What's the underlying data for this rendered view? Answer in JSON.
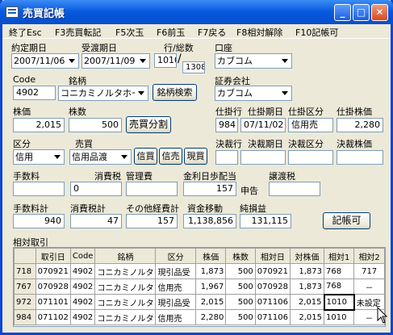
{
  "window": {
    "title": "売買記帳",
    "icon": "ledger-icon"
  },
  "titlebar_buttons": {
    "minimize": "_",
    "maximize": "□",
    "close": "✕"
  },
  "menu": [
    "終了Esc",
    "F3売買転記",
    "F5次玉",
    "F6前玉",
    "F7戻る",
    "F8相対解除",
    "F10記帳可"
  ],
  "form": {
    "contract_date": {
      "label": "約定期日",
      "value": "2007/11/06"
    },
    "settle_date": {
      "label": "受渡期日",
      "value": "2007/11/09"
    },
    "row_total": {
      "label": "行/総数",
      "row": "1010",
      "slash": "/",
      "total": "1308"
    },
    "account": {
      "label": "口座",
      "value": "カブコム"
    },
    "code": {
      "label": "Code",
      "value": "4902"
    },
    "issue": {
      "label": "銘柄",
      "value": "コニカミノルタホー."
    },
    "issue_search_label": "銘柄検索",
    "broker": {
      "label": "証券会社",
      "value": "カブコム"
    },
    "price": {
      "label": "株価",
      "value": "2,015"
    },
    "shares": {
      "label": "株数",
      "value": "500"
    },
    "split_label": "売買分割",
    "open_row": {
      "label": "仕掛行",
      "value": "984"
    },
    "open_date": {
      "label": "仕掛期日",
      "value": "07/11/02"
    },
    "open_type": {
      "label": "仕掛区分",
      "value": "信用売"
    },
    "open_price": {
      "label": "仕掛株価",
      "value": "2,280"
    },
    "kubun": {
      "label": "区分",
      "value": "信用"
    },
    "trade": {
      "label": "売買",
      "value": "信用品渡"
    },
    "credit_buy": "信買",
    "credit_sell": "信売",
    "spot_buy": "現買",
    "close_row": {
      "label": "決裁行",
      "value": ""
    },
    "close_date": {
      "label": "決裁期日",
      "value": ""
    },
    "close_type": {
      "label": "決裁区分",
      "value": ""
    },
    "close_price": {
      "label": "決裁株価",
      "value": ""
    },
    "fee": {
      "label": "手数料",
      "value": ""
    },
    "tax": {
      "label": "消費税",
      "value": "0"
    },
    "mgmt_fee": {
      "label": "管理費",
      "value": ""
    },
    "interest": {
      "label": "金利日歩配当",
      "value": "157"
    },
    "declare_label": "申告",
    "transfer_tax": {
      "label": "譲渡税",
      "value": ""
    },
    "fee_total": {
      "label": "手数料計",
      "value": "940"
    },
    "tax_total": {
      "label": "消費税計",
      "value": "47"
    },
    "other_total": {
      "label": "その他経費計",
      "value": "157"
    },
    "fund_move": {
      "label": "資金移動",
      "value": "1,138,856"
    },
    "net_profit": {
      "label": "純損益",
      "value": "131,115"
    },
    "record_enable_label": "記帳可"
  },
  "relative": {
    "label": "相対取引",
    "columns": [
      "",
      "取引日",
      "Code",
      "銘柄",
      "区分",
      "株価",
      "株数",
      "相対日",
      "対株価",
      "相対1",
      "相対2"
    ],
    "rows": [
      [
        "718",
        "070921",
        "4902",
        "コニカミノルタ",
        "現引品受",
        "1,873",
        "500",
        "070921",
        "1,873",
        "768",
        "717"
      ],
      [
        "767",
        "070928",
        "4902",
        "コニカミノルタ",
        "信用売",
        "1,967",
        "500",
        "070928",
        "1,873",
        "768",
        "－"
      ],
      [
        "972",
        "071101",
        "4902",
        "コニカミノルタ",
        "現引品受",
        "2,015",
        "500",
        "071106",
        "2,015",
        "1010",
        "未設定"
      ],
      [
        "984",
        "071102",
        "4902",
        "コニカミノルタ",
        "信用売",
        "2,280",
        "500",
        "071106",
        "2,015",
        "1010",
        "－"
      ]
    ]
  },
  "colors": {
    "titlebar": "#0a5be0",
    "face": "#ece9d8",
    "border": "#7f9db9"
  }
}
